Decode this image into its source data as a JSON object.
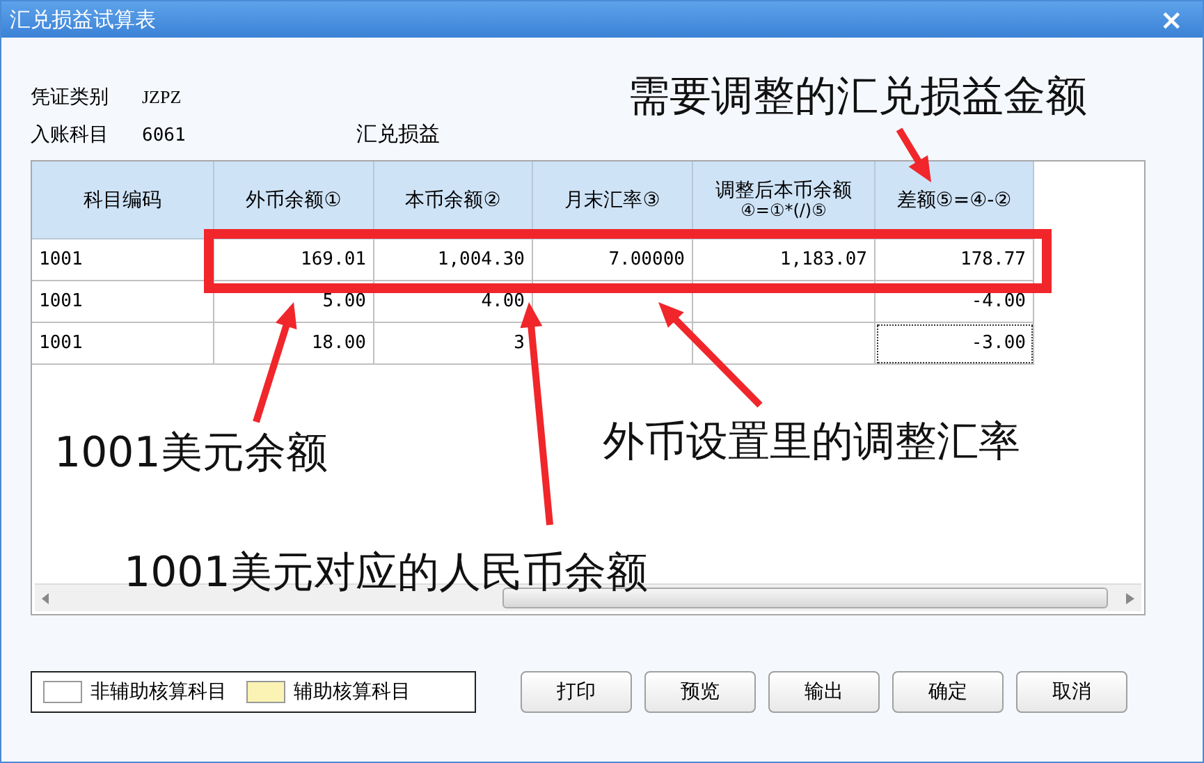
{
  "window": {
    "title": "汇兑损益试算表",
    "close": "×"
  },
  "voucher": {
    "label": "凭证类别",
    "value": "JZPZ"
  },
  "account": {
    "label": "入账科目",
    "code": "6061",
    "name": "汇兑损益"
  },
  "table": {
    "columns": [
      {
        "label": "科目编码"
      },
      {
        "label": "外币余额①"
      },
      {
        "label": "本币余额②"
      },
      {
        "label": "月末汇率③"
      },
      {
        "label": "调整后本币余额",
        "sub": "④=①*(/)⑤"
      },
      {
        "label": "差额⑤=④-②"
      }
    ],
    "rows": [
      {
        "code": "1001",
        "foreign": "169.01",
        "local": "1,004.30",
        "rate": "7.00000",
        "adjusted": "1,183.07",
        "difference": "178.77",
        "focused": false
      },
      {
        "code": "1001",
        "foreign": "5.00",
        "local": "4.00",
        "difference": "-4.00",
        "focused": false
      },
      {
        "code": "1001",
        "foreign": "18.00",
        "local": "3",
        "difference": "-3.00",
        "focused": true
      }
    ]
  },
  "legend": [
    {
      "label": "非辅助核算科目",
      "color": "#ffffff"
    },
    {
      "label": "辅助核算科目",
      "color": "#fbf3b4"
    }
  ],
  "buttons": [
    "打印",
    "预览",
    "输出",
    "确定",
    "取消"
  ],
  "annotations": [
    "需要调整的汇兑损益金额",
    "1001美元余额",
    "外币设置里的调整汇率",
    "1001美元对应的人民币余额"
  ]
}
